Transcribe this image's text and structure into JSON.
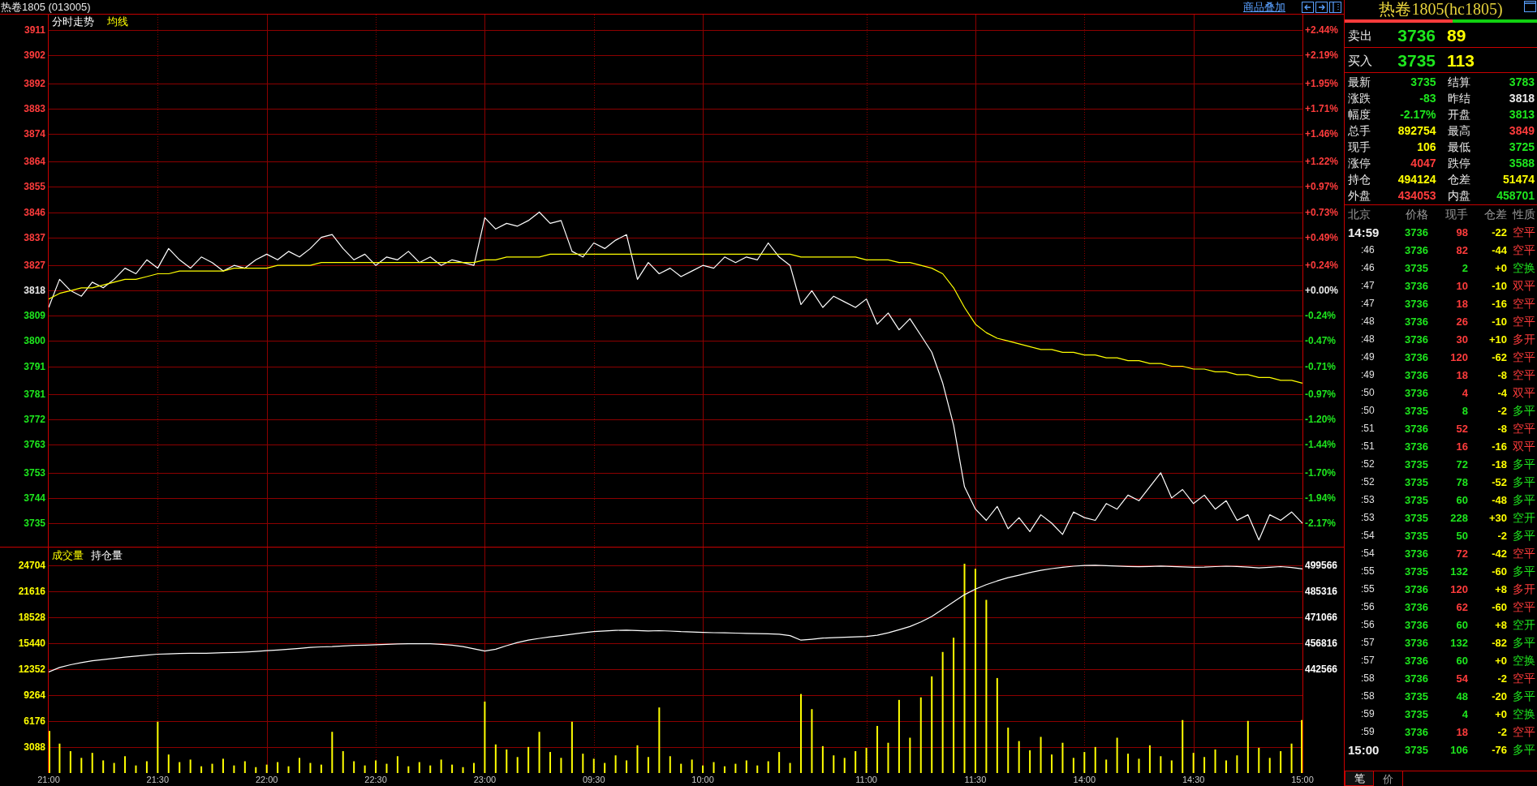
{
  "title_bar": {
    "title": "热卷1805 (013005)",
    "overlay_link": "商品叠加"
  },
  "price_panel": {
    "chart_data": {
      "type": "line",
      "grid": true,
      "ylim": [
        3726.6,
        3916.5
      ],
      "yticks": [
        3911,
        3902,
        3892,
        3883,
        3874,
        3864,
        3855,
        3846,
        3837,
        3827,
        3818,
        3809,
        3800,
        3791,
        3781,
        3772,
        3763,
        3753,
        3744,
        3735
      ],
      "categories": [
        null,
        null,
        null,
        null,
        null,
        null,
        null,
        null,
        null,
        null,
        null,
        null,
        null,
        null,
        null,
        null,
        null,
        null,
        null,
        null,
        null,
        null,
        null,
        null,
        null,
        null,
        null,
        null,
        null,
        null,
        null,
        null,
        null,
        null,
        null,
        null,
        null,
        null,
        null,
        null,
        null,
        null,
        null,
        null,
        null,
        null,
        null,
        null,
        null,
        null,
        null,
        null,
        null,
        null,
        null,
        null,
        null,
        null,
        null,
        null,
        null,
        null,
        null,
        null,
        null,
        null,
        null,
        null,
        null,
        null,
        null,
        null,
        null,
        null,
        null,
        null,
        null,
        null,
        null,
        null,
        null,
        null,
        null,
        null,
        null,
        null,
        null,
        null,
        null,
        null,
        null,
        null,
        null,
        null,
        null,
        null,
        null,
        null,
        null,
        null,
        null,
        null,
        null,
        null,
        null,
        null,
        null,
        null,
        null,
        null,
        null,
        null,
        null,
        null,
        null,
        null
      ],
      "series": [
        {
          "name": "分时走势",
          "color": "#ffffff",
          "values": [
            3812,
            3822,
            3818,
            3816,
            3821,
            3819,
            3822,
            3826,
            3824,
            3829,
            3826,
            3833,
            3829,
            3826,
            3830,
            3828,
            3825,
            3827,
            3826,
            3829,
            3831,
            3829,
            3832,
            3830,
            3833,
            3837,
            3838,
            3833,
            3829,
            3831,
            3827,
            3830,
            3829,
            3832,
            3828,
            3830,
            3827,
            3829,
            3828,
            3827,
            3844,
            3840,
            3842,
            3841,
            3843,
            3846,
            3842,
            3843,
            3832,
            3830,
            3835,
            3833,
            3836,
            3838,
            3822,
            3828,
            3824,
            3826,
            3823,
            3825,
            3827,
            3826,
            3830,
            3828,
            3830,
            3829,
            3835,
            3830,
            3827,
            3813,
            3818,
            3812,
            3816,
            3814,
            3812,
            3815,
            3806,
            3810,
            3804,
            3808,
            3802,
            3796,
            3785,
            3770,
            3748,
            3740,
            3736,
            3741,
            3733,
            3737,
            3732,
            3738,
            3735,
            3731,
            3739,
            3737,
            3736,
            3742,
            3740,
            3745,
            3743,
            3748,
            3753,
            3744,
            3747,
            3742,
            3745,
            3740,
            3743,
            3736,
            3738,
            3729,
            3738,
            3736,
            3739,
            3735
          ]
        },
        {
          "name": "均线",
          "color": "#ffff00",
          "values": [
            3815,
            3817,
            3818,
            3819,
            3819,
            3820,
            3821,
            3822,
            3822,
            3823,
            3824,
            3824,
            3825,
            3825,
            3825,
            3825,
            3825,
            3826,
            3826,
            3826,
            3826,
            3827,
            3827,
            3827,
            3827,
            3828,
            3828,
            3828,
            3828,
            3828,
            3828,
            3828,
            3828,
            3828,
            3828,
            3828,
            3828,
            3828,
            3828,
            3828,
            3829,
            3829,
            3830,
            3830,
            3830,
            3830,
            3831,
            3831,
            3831,
            3831,
            3831,
            3831,
            3831,
            3831,
            3831,
            3831,
            3831,
            3831,
            3831,
            3831,
            3831,
            3831,
            3831,
            3831,
            3831,
            3831,
            3831,
            3831,
            3831,
            3830,
            3830,
            3830,
            3830,
            3830,
            3830,
            3829,
            3829,
            3829,
            3828,
            3828,
            3827,
            3826,
            3824,
            3819,
            3812,
            3806,
            3803,
            3801,
            3800,
            3799,
            3798,
            3797,
            3797,
            3796,
            3796,
            3795,
            3795,
            3794,
            3794,
            3793,
            3793,
            3792,
            3792,
            3791,
            3791,
            3790,
            3790,
            3789,
            3789,
            3788,
            3788,
            3787,
            3787,
            3786,
            3786,
            3785
          ]
        }
      ]
    },
    "percent_scale": [
      {
        "label": "+2.44%",
        "color": "#ff3c3c"
      },
      {
        "label": "+2.19%",
        "color": "#ff3c3c"
      },
      {
        "label": "+1.95%",
        "color": "#ff3c3c"
      },
      {
        "label": "+1.71%",
        "color": "#ff3c3c"
      },
      {
        "label": "+1.46%",
        "color": "#ff3c3c"
      },
      {
        "label": "+1.22%",
        "color": "#ff3c3c"
      },
      {
        "label": "+0.97%",
        "color": "#ff3c3c"
      },
      {
        "label": "+0.73%",
        "color": "#ff3c3c"
      },
      {
        "label": "+0.49%",
        "color": "#ff3c3c"
      },
      {
        "label": "+0.24%",
        "color": "#ff3c3c"
      },
      {
        "label": "+0.00%",
        "color": "#e8e8e8"
      },
      {
        "label": "-0.24%",
        "color": "#1ee61e"
      },
      {
        "label": "-0.47%",
        "color": "#1ee61e"
      },
      {
        "label": "-0.71%",
        "color": "#1ee61e"
      },
      {
        "label": "-0.97%",
        "color": "#1ee61e"
      },
      {
        "label": "-1.20%",
        "color": "#1ee61e"
      },
      {
        "label": "-1.44%",
        "color": "#1ee61e"
      },
      {
        "label": "-1.70%",
        "color": "#1ee61e"
      },
      {
        "label": "-1.94%",
        "color": "#1ee61e"
      },
      {
        "label": "-2.17%",
        "color": "#1ee61e"
      }
    ]
  },
  "volume_panel": {
    "chart_data": {
      "type": "bar",
      "grid": true,
      "ylim": [
        0,
        26827
      ],
      "yticks": [
        24704,
        21616,
        18528,
        15440,
        12352,
        9264,
        6176,
        3088
      ],
      "categories": [
        "21:00",
        null,
        null,
        null,
        null,
        null,
        null,
        null,
        null,
        null,
        "21:30",
        null,
        null,
        null,
        null,
        null,
        null,
        null,
        null,
        null,
        "22:00",
        null,
        null,
        null,
        null,
        null,
        null,
        null,
        null,
        null,
        "22:30",
        null,
        null,
        null,
        null,
        null,
        null,
        null,
        null,
        null,
        "23:00",
        null,
        null,
        null,
        null,
        null,
        null,
        null,
        null,
        null,
        "09:30",
        null,
        null,
        null,
        null,
        null,
        null,
        null,
        null,
        null,
        "10:00",
        null,
        null,
        null,
        null,
        null,
        null,
        null,
        null,
        null,
        null,
        null,
        null,
        null,
        null,
        "11:00",
        null,
        null,
        null,
        null,
        null,
        null,
        null,
        null,
        null,
        "11:30",
        null,
        null,
        null,
        null,
        null,
        null,
        null,
        null,
        null,
        "14:00",
        null,
        null,
        null,
        null,
        null,
        null,
        null,
        null,
        null,
        "14:30",
        null,
        null,
        null,
        null,
        null,
        null,
        null,
        null,
        null,
        "15:00"
      ],
      "series": [
        {
          "name": "成交量",
          "color": "#ffff00",
          "values": [
            5000,
            3500,
            2600,
            1800,
            2400,
            1500,
            1200,
            2000,
            900,
            1400,
            6100,
            2200,
            1300,
            1600,
            800,
            1100,
            1700,
            900,
            1400,
            700,
            1000,
            1300,
            800,
            1800,
            1200,
            1000,
            4900,
            2600,
            1400,
            900,
            1500,
            1100,
            2000,
            800,
            1300,
            900,
            1600,
            1000,
            700,
            1200,
            8500,
            3400,
            2800,
            1900,
            3100,
            4900,
            2500,
            1800,
            6100,
            2300,
            1700,
            1200,
            2100,
            1500,
            3300,
            1900,
            7800,
            2000,
            1100,
            1600,
            900,
            1300,
            800,
            1100,
            1500,
            900,
            1400,
            2500,
            1200,
            9400,
            7600,
            3200,
            2100,
            1800,
            2600,
            3000,
            5600,
            3600,
            8700,
            4200,
            9000,
            11500,
            14400,
            16100,
            24900,
            24300,
            20600,
            11300,
            5400,
            3800,
            2700,
            4300,
            2200,
            3600,
            1800,
            2500,
            3100,
            1600,
            4200,
            2300,
            1700,
            3300,
            2000,
            1500,
            6300,
            2400,
            1900,
            2800,
            1500,
            2100,
            6200,
            3000,
            1800,
            2600,
            3500,
            6300
          ]
        }
      ]
    }
  },
  "open_interest_overlay": {
    "chart_data": {
      "type": "line",
      "ylim": [
        385566,
        509363
      ],
      "yticks": [
        499566,
        485316,
        471066,
        456816,
        442566
      ],
      "categories": [
        null,
        null,
        null,
        null,
        null,
        null,
        null,
        null,
        null,
        null,
        null,
        null,
        null,
        null,
        null,
        null,
        null,
        null,
        null,
        null,
        null,
        null,
        null,
        null,
        null,
        null,
        null,
        null,
        null,
        null,
        null,
        null,
        null,
        null,
        null,
        null,
        null,
        null,
        null,
        null,
        null,
        null,
        null,
        null,
        null,
        null,
        null,
        null,
        null,
        null,
        null,
        null,
        null,
        null,
        null,
        null,
        null,
        null,
        null,
        null,
        null,
        null,
        null,
        null,
        null,
        null,
        null,
        null,
        null,
        null,
        null,
        null,
        null,
        null,
        null,
        null,
        null,
        null,
        null,
        null,
        null,
        null,
        null,
        null,
        null,
        null,
        null,
        null,
        null,
        null,
        null,
        null,
        null,
        null,
        null,
        null,
        null,
        null,
        null,
        null,
        null,
        null,
        null,
        null,
        null,
        null,
        null,
        null,
        null,
        null,
        null,
        null,
        null,
        null,
        null,
        null
      ],
      "series": [
        {
          "name": "持仓量",
          "color": "#ffffff",
          "values": [
            441000,
            443500,
            445000,
            446200,
            447200,
            447800,
            448500,
            449200,
            449800,
            450300,
            450800,
            451000,
            451200,
            451300,
            451300,
            451400,
            451600,
            451800,
            452000,
            452300,
            452700,
            453100,
            453500,
            454000,
            454500,
            454800,
            455000,
            455300,
            455600,
            455800,
            456000,
            456200,
            456400,
            456500,
            456600,
            456500,
            456200,
            455800,
            455000,
            453800,
            452500,
            453500,
            455500,
            457200,
            458500,
            459500,
            460300,
            461000,
            461800,
            462500,
            463200,
            463600,
            463900,
            464000,
            463800,
            463600,
            463700,
            463500,
            463200,
            463000,
            462800,
            462600,
            462500,
            462400,
            462200,
            462100,
            462000,
            461800,
            461000,
            458500,
            459000,
            459600,
            459900,
            460100,
            460300,
            460500,
            461200,
            462500,
            464200,
            466000,
            468500,
            471500,
            475500,
            479500,
            483500,
            486500,
            489000,
            491000,
            492800,
            494200,
            495600,
            496800,
            497800,
            498500,
            499100,
            499500,
            499600,
            499400,
            499200,
            499000,
            498800,
            499000,
            499200,
            499000,
            498700,
            498500,
            498600,
            498900,
            499100,
            499000,
            498600,
            498200,
            498500,
            498900,
            498400,
            497600
          ]
        }
      ]
    }
  },
  "quote_panel": {
    "title": "热卷1805(hc1805)",
    "ratio_bar": {
      "level": 0.56
    },
    "quotes": [
      {
        "label": "卖出",
        "price": "3736",
        "volume": "89",
        "falling": true
      },
      {
        "label": "买入",
        "price": "3735",
        "volume": "113",
        "falling": true
      }
    ],
    "stats": [
      {
        "label": "最新",
        "value": "3735",
        "color": "#1ee61e"
      },
      {
        "label": "结算",
        "value": "3783",
        "color": "#1ee61e"
      },
      {
        "label": "涨跌",
        "value": "-83",
        "color": "#1ee61e"
      },
      {
        "label": "昨结",
        "value": "3818",
        "color": "#e8e8e8"
      },
      {
        "label": "幅度",
        "value": "-2.17%",
        "color": "#1ee61e"
      },
      {
        "label": "开盘",
        "value": "3813",
        "color": "#1ee61e"
      },
      {
        "label": "总手",
        "value": "892754",
        "color": "#ffff00"
      },
      {
        "label": "最高",
        "value": "3849",
        "color": "#ff3c3c"
      },
      {
        "label": "现手",
        "value": "106",
        "color": "#ffff00"
      },
      {
        "label": "最低",
        "value": "3725",
        "color": "#1ee61e"
      },
      {
        "label": "涨停",
        "value": "4047",
        "color": "#ff3c3c"
      },
      {
        "label": "跌停",
        "value": "3588",
        "color": "#1ee61e"
      },
      {
        "label": "持仓",
        "value": "494124",
        "color": "#ffff00"
      },
      {
        "label": "仓差",
        "value": "51474",
        "color": "#ffff00"
      },
      {
        "label": "外盘",
        "value": "434053",
        "color": "#ff3c3c"
      },
      {
        "label": "内盘",
        "value": "458701",
        "color": "#1ee61e"
      }
    ]
  },
  "trade_list": {
    "columns": [
      "北京",
      "价格",
      "现手",
      "仓差",
      "性质"
    ],
    "prices_falling": true,
    "rows": [
      {
        "kind": "full",
        "time": "14:59",
        "price": "3736",
        "volume": "98",
        "oi_change": "-22",
        "nature": "空平",
        "color": "#ff3c3c"
      },
      {
        "kind": "short",
        "time": ":46",
        "price": "3736",
        "volume": "82",
        "oi_change": "-44",
        "nature": "空平",
        "color": "#ff3c3c"
      },
      {
        "kind": "short",
        "time": ":46",
        "price": "3735",
        "volume": "2",
        "oi_change": "+0",
        "nature": "空换",
        "color": "#1ee61e"
      },
      {
        "kind": "short",
        "time": ":47",
        "price": "3736",
        "volume": "10",
        "oi_change": "-10",
        "nature": "双平",
        "color": "#ff3c3c"
      },
      {
        "kind": "short",
        "time": ":47",
        "price": "3736",
        "volume": "18",
        "oi_change": "-16",
        "nature": "空平",
        "color": "#ff3c3c"
      },
      {
        "kind": "short",
        "time": ":48",
        "price": "3736",
        "volume": "26",
        "oi_change": "-10",
        "nature": "空平",
        "color": "#ff3c3c"
      },
      {
        "kind": "short",
        "time": ":48",
        "price": "3736",
        "volume": "30",
        "oi_change": "+10",
        "nature": "多开",
        "color": "#ff3c3c"
      },
      {
        "kind": "short",
        "time": ":49",
        "price": "3736",
        "volume": "120",
        "oi_change": "-62",
        "nature": "空平",
        "color": "#ff3c3c"
      },
      {
        "kind": "short",
        "time": ":49",
        "price": "3736",
        "volume": "18",
        "oi_change": "-8",
        "nature": "空平",
        "color": "#ff3c3c"
      },
      {
        "kind": "short",
        "time": ":50",
        "price": "3736",
        "volume": "4",
        "oi_change": "-4",
        "nature": "双平",
        "color": "#ff3c3c"
      },
      {
        "kind": "short",
        "time": ":50",
        "price": "3735",
        "volume": "8",
        "oi_change": "-2",
        "nature": "多平",
        "color": "#1ee61e"
      },
      {
        "kind": "short",
        "time": ":51",
        "price": "3736",
        "volume": "52",
        "oi_change": "-8",
        "nature": "空平",
        "color": "#ff3c3c"
      },
      {
        "kind": "short",
        "time": ":51",
        "price": "3736",
        "volume": "16",
        "oi_change": "-16",
        "nature": "双平",
        "color": "#ff3c3c"
      },
      {
        "kind": "short",
        "time": ":52",
        "price": "3735",
        "volume": "72",
        "oi_change": "-18",
        "nature": "多平",
        "color": "#1ee61e"
      },
      {
        "kind": "short",
        "time": ":52",
        "price": "3735",
        "volume": "78",
        "oi_change": "-52",
        "nature": "多平",
        "color": "#1ee61e"
      },
      {
        "kind": "short",
        "time": ":53",
        "price": "3735",
        "volume": "60",
        "oi_change": "-48",
        "nature": "多平",
        "color": "#1ee61e"
      },
      {
        "kind": "short",
        "time": ":53",
        "price": "3735",
        "volume": "228",
        "oi_change": "+30",
        "nature": "空开",
        "color": "#1ee61e"
      },
      {
        "kind": "short",
        "time": ":54",
        "price": "3735",
        "volume": "50",
        "oi_change": "-2",
        "nature": "多平",
        "color": "#1ee61e"
      },
      {
        "kind": "short",
        "time": ":54",
        "price": "3736",
        "volume": "72",
        "oi_change": "-42",
        "nature": "空平",
        "color": "#ff3c3c"
      },
      {
        "kind": "short",
        "time": ":55",
        "price": "3735",
        "volume": "132",
        "oi_change": "-60",
        "nature": "多平",
        "color": "#1ee61e"
      },
      {
        "kind": "short",
        "time": ":55",
        "price": "3736",
        "volume": "120",
        "oi_change": "+8",
        "nature": "多开",
        "color": "#ff3c3c"
      },
      {
        "kind": "short",
        "time": ":56",
        "price": "3736",
        "volume": "62",
        "oi_change": "-60",
        "nature": "空平",
        "color": "#ff3c3c"
      },
      {
        "kind": "short",
        "time": ":56",
        "price": "3736",
        "volume": "60",
        "oi_change": "+8",
        "nature": "空开",
        "color": "#1ee61e"
      },
      {
        "kind": "short",
        "time": ":57",
        "price": "3736",
        "volume": "132",
        "oi_change": "-82",
        "nature": "多平",
        "color": "#1ee61e"
      },
      {
        "kind": "short",
        "time": ":57",
        "price": "3736",
        "volume": "60",
        "oi_change": "+0",
        "nature": "空换",
        "color": "#1ee61e"
      },
      {
        "kind": "short",
        "time": ":58",
        "price": "3736",
        "volume": "54",
        "oi_change": "-2",
        "nature": "空平",
        "color": "#ff3c3c"
      },
      {
        "kind": "short",
        "time": ":58",
        "price": "3735",
        "volume": "48",
        "oi_change": "-20",
        "nature": "多平",
        "color": "#1ee61e"
      },
      {
        "kind": "short",
        "time": ":59",
        "price": "3735",
        "volume": "4",
        "oi_change": "+0",
        "nature": "空换",
        "color": "#1ee61e"
      },
      {
        "kind": "short",
        "time": ":59",
        "price": "3736",
        "volume": "18",
        "oi_change": "-2",
        "nature": "空平",
        "color": "#ff3c3c"
      },
      {
        "kind": "full",
        "time": "15:00",
        "price": "3735",
        "volume": "106",
        "oi_change": "-76",
        "nature": "多平",
        "color": "#1ee61e"
      }
    ]
  },
  "bottom_tabs": [
    {
      "label": "笔",
      "selected": true
    },
    {
      "label": "价",
      "selected": false
    }
  ]
}
